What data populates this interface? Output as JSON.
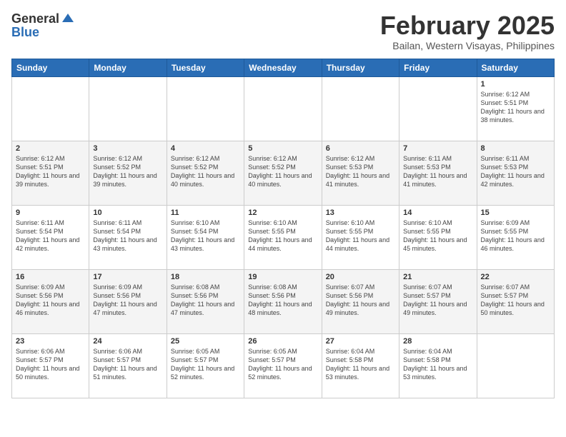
{
  "header": {
    "logo_general": "General",
    "logo_blue": "Blue",
    "month_title": "February 2025",
    "location": "Bailan, Western Visayas, Philippines"
  },
  "days_of_week": [
    "Sunday",
    "Monday",
    "Tuesday",
    "Wednesday",
    "Thursday",
    "Friday",
    "Saturday"
  ],
  "weeks": [
    [
      {
        "day": "",
        "info": ""
      },
      {
        "day": "",
        "info": ""
      },
      {
        "day": "",
        "info": ""
      },
      {
        "day": "",
        "info": ""
      },
      {
        "day": "",
        "info": ""
      },
      {
        "day": "",
        "info": ""
      },
      {
        "day": "1",
        "info": "Sunrise: 6:12 AM\nSunset: 5:51 PM\nDaylight: 11 hours and 38 minutes."
      }
    ],
    [
      {
        "day": "2",
        "info": "Sunrise: 6:12 AM\nSunset: 5:51 PM\nDaylight: 11 hours and 39 minutes."
      },
      {
        "day": "3",
        "info": "Sunrise: 6:12 AM\nSunset: 5:52 PM\nDaylight: 11 hours and 39 minutes."
      },
      {
        "day": "4",
        "info": "Sunrise: 6:12 AM\nSunset: 5:52 PM\nDaylight: 11 hours and 40 minutes."
      },
      {
        "day": "5",
        "info": "Sunrise: 6:12 AM\nSunset: 5:52 PM\nDaylight: 11 hours and 40 minutes."
      },
      {
        "day": "6",
        "info": "Sunrise: 6:12 AM\nSunset: 5:53 PM\nDaylight: 11 hours and 41 minutes."
      },
      {
        "day": "7",
        "info": "Sunrise: 6:11 AM\nSunset: 5:53 PM\nDaylight: 11 hours and 41 minutes."
      },
      {
        "day": "8",
        "info": "Sunrise: 6:11 AM\nSunset: 5:53 PM\nDaylight: 11 hours and 42 minutes."
      }
    ],
    [
      {
        "day": "9",
        "info": "Sunrise: 6:11 AM\nSunset: 5:54 PM\nDaylight: 11 hours and 42 minutes."
      },
      {
        "day": "10",
        "info": "Sunrise: 6:11 AM\nSunset: 5:54 PM\nDaylight: 11 hours and 43 minutes."
      },
      {
        "day": "11",
        "info": "Sunrise: 6:10 AM\nSunset: 5:54 PM\nDaylight: 11 hours and 43 minutes."
      },
      {
        "day": "12",
        "info": "Sunrise: 6:10 AM\nSunset: 5:55 PM\nDaylight: 11 hours and 44 minutes."
      },
      {
        "day": "13",
        "info": "Sunrise: 6:10 AM\nSunset: 5:55 PM\nDaylight: 11 hours and 44 minutes."
      },
      {
        "day": "14",
        "info": "Sunrise: 6:10 AM\nSunset: 5:55 PM\nDaylight: 11 hours and 45 minutes."
      },
      {
        "day": "15",
        "info": "Sunrise: 6:09 AM\nSunset: 5:55 PM\nDaylight: 11 hours and 46 minutes."
      }
    ],
    [
      {
        "day": "16",
        "info": "Sunrise: 6:09 AM\nSunset: 5:56 PM\nDaylight: 11 hours and 46 minutes."
      },
      {
        "day": "17",
        "info": "Sunrise: 6:09 AM\nSunset: 5:56 PM\nDaylight: 11 hours and 47 minutes."
      },
      {
        "day": "18",
        "info": "Sunrise: 6:08 AM\nSunset: 5:56 PM\nDaylight: 11 hours and 47 minutes."
      },
      {
        "day": "19",
        "info": "Sunrise: 6:08 AM\nSunset: 5:56 PM\nDaylight: 11 hours and 48 minutes."
      },
      {
        "day": "20",
        "info": "Sunrise: 6:07 AM\nSunset: 5:56 PM\nDaylight: 11 hours and 49 minutes."
      },
      {
        "day": "21",
        "info": "Sunrise: 6:07 AM\nSunset: 5:57 PM\nDaylight: 11 hours and 49 minutes."
      },
      {
        "day": "22",
        "info": "Sunrise: 6:07 AM\nSunset: 5:57 PM\nDaylight: 11 hours and 50 minutes."
      }
    ],
    [
      {
        "day": "23",
        "info": "Sunrise: 6:06 AM\nSunset: 5:57 PM\nDaylight: 11 hours and 50 minutes."
      },
      {
        "day": "24",
        "info": "Sunrise: 6:06 AM\nSunset: 5:57 PM\nDaylight: 11 hours and 51 minutes."
      },
      {
        "day": "25",
        "info": "Sunrise: 6:05 AM\nSunset: 5:57 PM\nDaylight: 11 hours and 52 minutes."
      },
      {
        "day": "26",
        "info": "Sunrise: 6:05 AM\nSunset: 5:57 PM\nDaylight: 11 hours and 52 minutes."
      },
      {
        "day": "27",
        "info": "Sunrise: 6:04 AM\nSunset: 5:58 PM\nDaylight: 11 hours and 53 minutes."
      },
      {
        "day": "28",
        "info": "Sunrise: 6:04 AM\nSunset: 5:58 PM\nDaylight: 11 hours and 53 minutes."
      },
      {
        "day": "",
        "info": ""
      }
    ]
  ]
}
